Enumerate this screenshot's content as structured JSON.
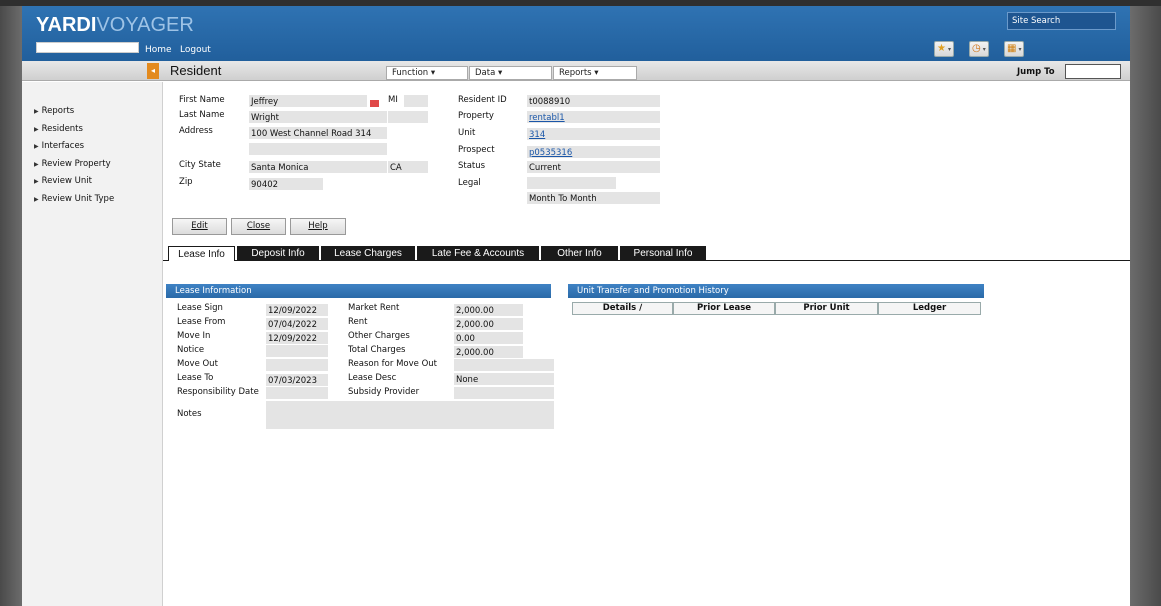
{
  "app": {
    "brand_part1": "YARDI",
    "brand_part2": "VOYAGER"
  },
  "header": {
    "home": "Home",
    "logout": "Logout",
    "site_search": "Site Search",
    "icons": [
      "star-icon",
      "clock-icon",
      "grid-icon"
    ]
  },
  "titlebar": {
    "title": "Resident",
    "function": "Function  ▾",
    "data": "Data  ▾",
    "reports": "Reports  ▾",
    "jump_to": "Jump To"
  },
  "sidebar": {
    "items": [
      "Reports",
      "Residents",
      "Interfaces",
      "Review Property",
      "Review Unit",
      "Review Unit Type"
    ]
  },
  "resident": {
    "first_name_label": "First Name",
    "first_name": "Jeffrey",
    "mi_label": "MI",
    "last_name_label": "Last Name",
    "last_name": "Wright",
    "address_label": "Address",
    "address1": "100 West Channel Road 314",
    "address2": "",
    "city_state_label": "City State",
    "city": "Santa Monica",
    "state": "CA",
    "zip_label": "Zip",
    "zip": "90402",
    "resident_id_label": "Resident ID",
    "resident_id": "t0088910",
    "property_label": "Property",
    "property": "rentabl1",
    "unit_label": "Unit",
    "unit": "314",
    "prospect_label": "Prospect",
    "prospect": "p0535316",
    "status_label": "Status",
    "status": "Current",
    "legal_label": "Legal",
    "legal": "",
    "term": "Month To Month"
  },
  "buttons": {
    "edit": "Edit",
    "close": "Close",
    "help": "Help"
  },
  "tabs": [
    "Lease Info",
    "Deposit Info",
    "Lease Charges",
    "Late Fee & Accounts",
    "Other Info",
    "Personal Info"
  ],
  "lease": {
    "section_title": "Lease Information",
    "lease_sign_label": "Lease Sign",
    "lease_sign": "12/09/2022",
    "lease_from_label": "Lease From",
    "lease_from": "07/04/2022",
    "move_in_label": "Move In",
    "move_in": "12/09/2022",
    "notice_label": "Notice",
    "notice": "",
    "move_out_label": "Move Out",
    "move_out": "",
    "lease_to_label": "Lease To",
    "lease_to": "07/03/2023",
    "resp_date_label": "Responsibility Date",
    "resp_date": "",
    "notes_label": "Notes",
    "market_rent_label": "Market Rent",
    "market_rent": "2,000.00",
    "rent_label": "Rent",
    "rent": "2,000.00",
    "other_charges_label": "Other Charges",
    "other_charges": "0.00",
    "total_charges_label": "Total Charges",
    "total_charges": "2,000.00",
    "reason_label": "Reason for Move Out",
    "reason": "",
    "lease_desc_label": "Lease Desc",
    "lease_desc": "None",
    "subsidy_label": "Subsidy Provider",
    "subsidy": ""
  },
  "history": {
    "section_title": "Unit Transfer and Promotion History",
    "columns": [
      "Details ∕",
      "Prior Lease",
      "Prior Unit",
      "Ledger"
    ]
  }
}
